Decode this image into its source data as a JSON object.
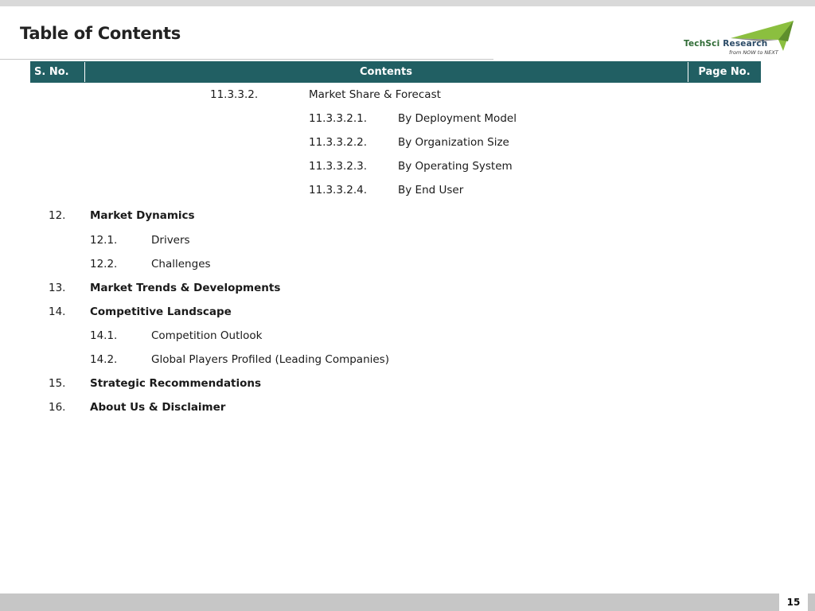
{
  "page": {
    "title": "Table of Contents",
    "page_number": "15"
  },
  "logo": {
    "brand_part1": "TechSci",
    "brand_part2": " Research",
    "tagline": "from NOW to NEXT"
  },
  "table": {
    "headers": {
      "sno": "S. No.",
      "contents": "Contents",
      "page_no": "Page No."
    },
    "rows": [
      {
        "num": "11.3.3.2.",
        "label": "Market Share & Forecast",
        "bold": false
      },
      {
        "num": "11.3.3.2.1.",
        "label": "By Deployment Model",
        "bold": false
      },
      {
        "num": "11.3.3.2.2.",
        "label": "By Organization Size",
        "bold": false
      },
      {
        "num": "11.3.3.2.3.",
        "label": "By Operating System",
        "bold": false
      },
      {
        "num": "11.3.3.2.4.",
        "label": "By End User",
        "bold": false
      },
      {
        "num": "12.",
        "label": "Market Dynamics",
        "bold": true
      },
      {
        "num": "12.1.",
        "label": "Drivers",
        "bold": false
      },
      {
        "num": "12.2.",
        "label": "Challenges",
        "bold": false
      },
      {
        "num": "13.",
        "label": "Market Trends & Developments",
        "bold": true
      },
      {
        "num": "14.",
        "label": "Competitive Landscape",
        "bold": true
      },
      {
        "num": "14.1.",
        "label": "Competition Outlook",
        "bold": false
      },
      {
        "num": "14.2.",
        "label": "Global Players Profiled (Leading Companies)",
        "bold": false
      },
      {
        "num": "15.",
        "label": "Strategic Recommendations",
        "bold": true
      },
      {
        "num": "16.",
        "label": "About Us & Disclaimer",
        "bold": true
      }
    ]
  },
  "colors": {
    "header_bg": "#215f63",
    "logo_green": "#8bbf3f",
    "logo_gray": "#8c8c8c"
  }
}
